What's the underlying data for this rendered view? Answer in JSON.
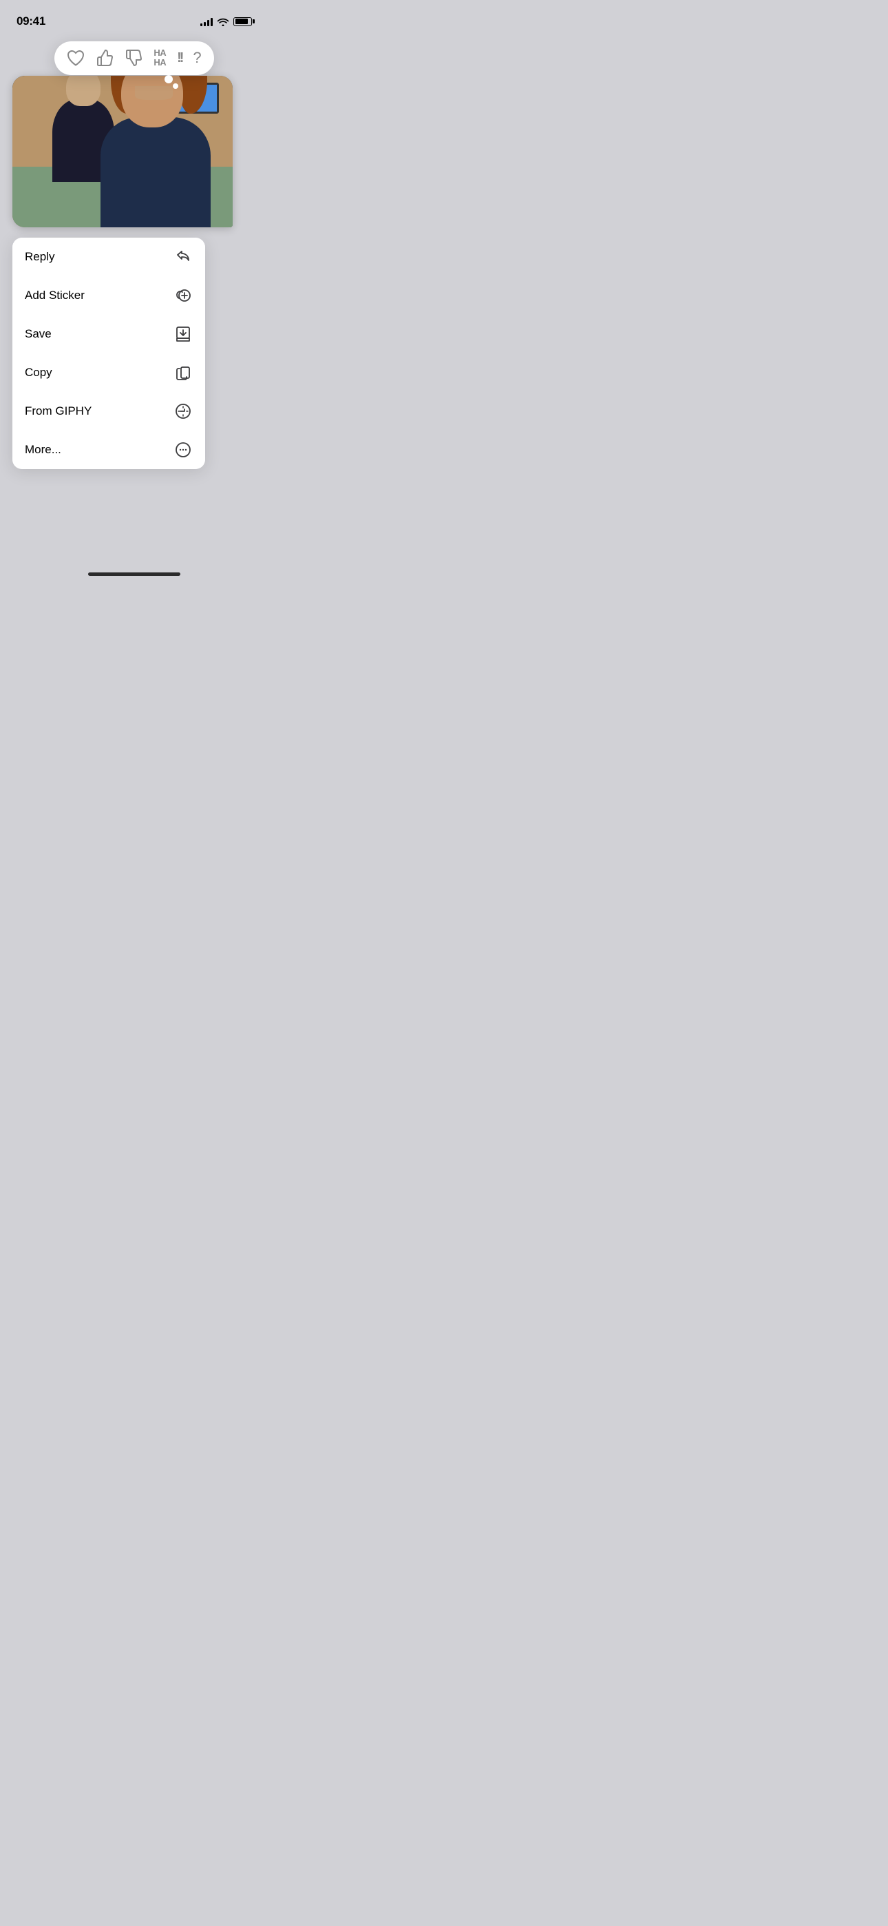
{
  "statusBar": {
    "time": "09:41",
    "batteryLevel": 85
  },
  "reactions": {
    "items": [
      {
        "id": "heart",
        "symbol": "♥",
        "label": "heart"
      },
      {
        "id": "thumbsup",
        "symbol": "👍",
        "label": "thumbs up"
      },
      {
        "id": "thumbsdown",
        "symbol": "👎",
        "label": "thumbs down"
      },
      {
        "id": "haha",
        "symbol": "HA\nHA",
        "label": "haha"
      },
      {
        "id": "exclaim",
        "symbol": "!!",
        "label": "exclamation"
      },
      {
        "id": "question",
        "symbol": "?",
        "label": "question"
      }
    ]
  },
  "contextMenu": {
    "items": [
      {
        "id": "reply",
        "label": "Reply",
        "icon": "reply"
      },
      {
        "id": "add-sticker",
        "label": "Add Sticker",
        "icon": "sticker"
      },
      {
        "id": "save",
        "label": "Save",
        "icon": "save"
      },
      {
        "id": "copy",
        "label": "Copy",
        "icon": "copy"
      },
      {
        "id": "from-giphy",
        "label": "From GIPHY",
        "icon": "giphy"
      },
      {
        "id": "more",
        "label": "More...",
        "icon": "more"
      }
    ]
  }
}
